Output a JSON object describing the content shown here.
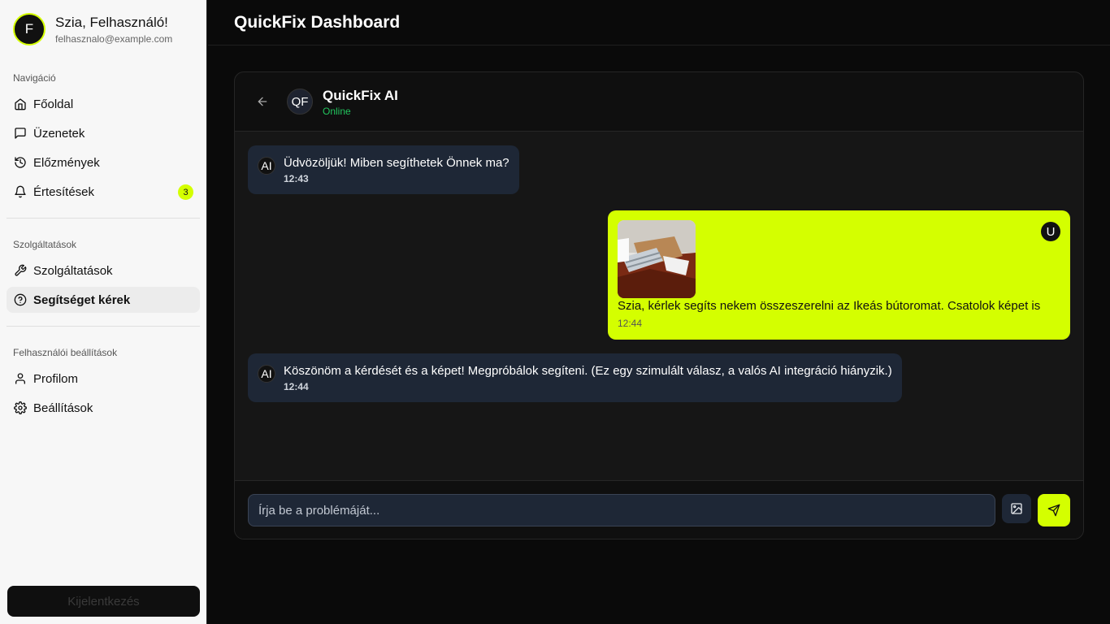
{
  "sidebar": {
    "avatar_letter": "F",
    "greeting": "Szia, Felhasználó!",
    "email": "felhasznalo@example.com",
    "sections": [
      {
        "title": "Navigáció"
      },
      {
        "title": "Szolgáltatások"
      },
      {
        "title": "Felhasználói beállítások"
      }
    ],
    "items": [
      {
        "label": "Főoldal",
        "icon": "home-icon"
      },
      {
        "label": "Üzenetek",
        "icon": "message-icon"
      },
      {
        "label": "Előzmények",
        "icon": "history-icon"
      },
      {
        "label": "Értesítések",
        "icon": "bell-icon",
        "badge": "3"
      },
      {
        "label": "Szolgáltatások",
        "icon": "wrench-icon"
      },
      {
        "label": "Segítséget kérek",
        "icon": "help-circle-icon",
        "active": true
      },
      {
        "label": "Profilom",
        "icon": "user-icon"
      },
      {
        "label": "Beállítások",
        "icon": "gear-icon"
      }
    ],
    "logout_label": "Kijelentkezés"
  },
  "header": {
    "title": "QuickFix Dashboard"
  },
  "chat": {
    "avatar": "QF",
    "name": "QuickFix AI",
    "status": "Online",
    "messages": [
      {
        "sender": "AI",
        "text": "Üdvözöljük! Miben segíthetek Önnek ma?",
        "time": "12:43"
      },
      {
        "sender": "U",
        "text": "Szia, kérlek segíts nekem összeszerelni az Ikeás bútoromat. Csatolok képet is",
        "time": "12:44",
        "has_image": true
      },
      {
        "sender": "AI",
        "text": "Köszönöm a kérdését és a képet! Megpróbálok segíteni. (Ez egy szimulált válasz, a valós AI integráció hiányzik.)",
        "time": "12:44"
      }
    ],
    "input_placeholder": "Írja be a problémáját..."
  },
  "colors": {
    "accent": "#d4ff00",
    "online": "#22c55e",
    "bubble_ai": "#1e2736"
  }
}
